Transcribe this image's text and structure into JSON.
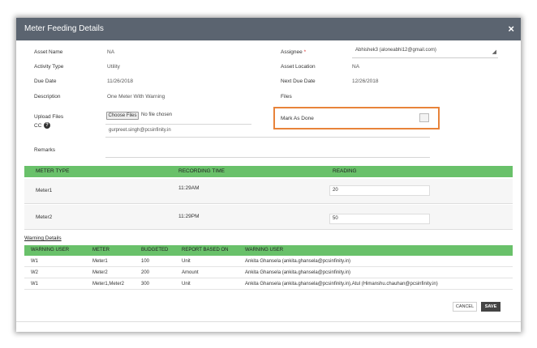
{
  "dialog": {
    "title": "Meter Feeding Details",
    "close_symbol": "×"
  },
  "form": {
    "asset_name_label": "Asset Name",
    "asset_name_value": "NA",
    "activity_type_label": "Activity Type",
    "activity_type_value": "Utility",
    "due_date_label": "Due Date",
    "due_date_value": "11/26/2018",
    "description_label": "Description",
    "description_value": "One Meter With Warning",
    "upload_files_label": "Upload Files",
    "choose_files_label": "Choose Files",
    "no_file_text": "No file chosen",
    "cc_label": "CC",
    "cc_value": "gurpreet.singh@pcsinfinity.in",
    "remarks_label": "Remarks",
    "assignee_label": "Assignee",
    "assignee_required": "*",
    "assignee_value": "Abhishek3 (aloneabhi12@gmail.com)",
    "asset_location_label": "Asset Location",
    "asset_location_value": "NA",
    "next_due_date_label": "Next Due Date",
    "next_due_date_value": "12/26/2018",
    "files_label": "Files",
    "mark_as_done_label": "Mark As Done"
  },
  "meters": {
    "headers": [
      "METER TYPE",
      "RECORDING TIME",
      "READING"
    ],
    "rows": [
      {
        "type": "Meter1",
        "time": "11:29AM",
        "reading": "20"
      },
      {
        "type": "Meter2",
        "time": "11:29PM",
        "reading": "50"
      }
    ]
  },
  "warnings": {
    "title": "Warning Details",
    "headers": [
      "WARNING USER",
      "METER",
      "BUDGETED",
      "REPORT BASED ON",
      "WARNING USER"
    ],
    "rows": [
      [
        "W1",
        "Meter1",
        "100",
        "Unit",
        "Ankita Ghansela (ankita.ghansela@pcsinfinity.in)"
      ],
      [
        "W2",
        "Meter2",
        "200",
        "Amount",
        "Ankita Ghansela (ankita.ghansela@pcsinfinity.in)"
      ],
      [
        "W1",
        "Meter1,Meter2",
        "300",
        "Unit",
        "Ankita Ghansela (ankita.ghansela@pcsinfinity.in),Atul (Himanshu.chauhan@pcsinfinity.in)"
      ]
    ]
  },
  "actions": {
    "cancel_label": "CANCEL",
    "save_label": "SAVE"
  },
  "colors": {
    "titlebar": "#5b6470",
    "green_header": "#69c16a",
    "highlight": "#e8833a",
    "save_button": "#444444"
  }
}
